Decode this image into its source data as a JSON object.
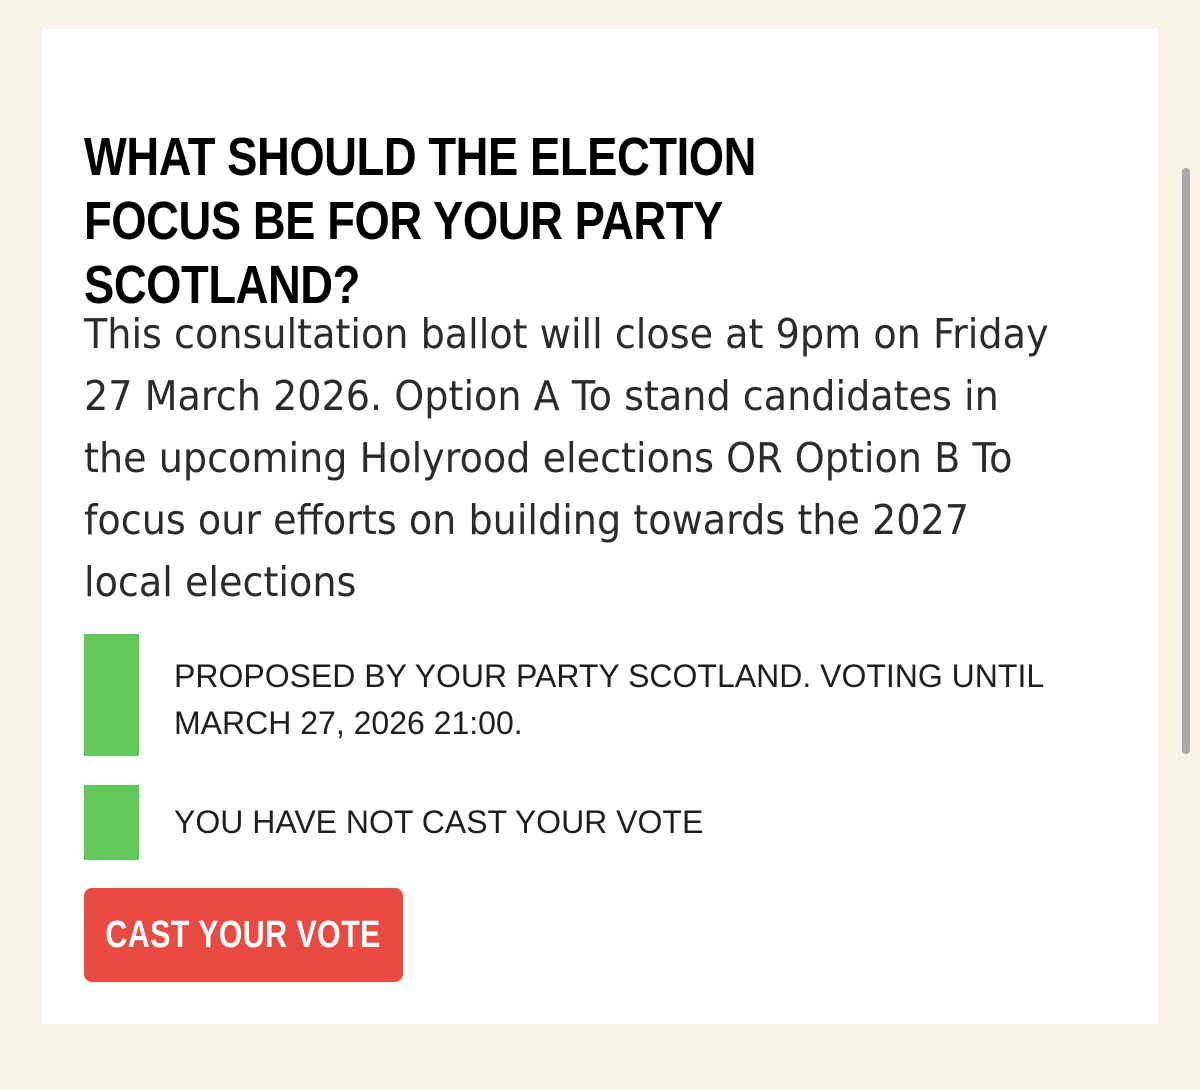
{
  "ballot": {
    "title": "WHAT SHOULD THE ELECTION FOCUS BE FOR YOUR PARTY SCOTLAND?",
    "description": "This consultation ballot will close at 9pm on Friday 27 March 2026. Option A To stand candidates in the upcoming Holyrood elections OR Option B To focus our efforts on building towards the 2027 local elections",
    "proposed_info": "PROPOSED BY YOUR PARTY SCOTLAND. VOTING UNTIL MARCH 27, 2026 21:00.",
    "vote_status": "YOU HAVE NOT CAST YOUR VOTE",
    "cast_vote_label": "CAST YOUR VOTE"
  },
  "colors": {
    "page_background": "#f8f4e6",
    "card_background": "#ffffff",
    "status_indicator": "#63c85a",
    "button_background": "#e94a41",
    "button_text": "#ffffff"
  }
}
